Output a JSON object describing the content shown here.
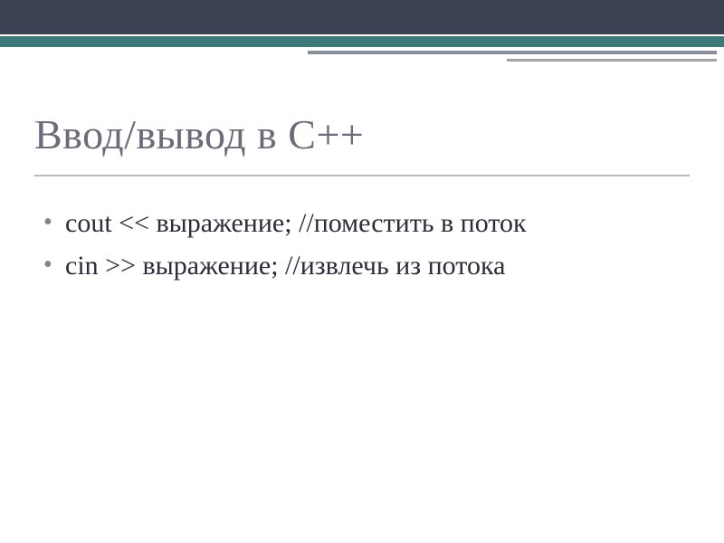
{
  "slide": {
    "title": "Ввод/вывод в C++",
    "bullets": [
      "cout << выражение; //поместить в поток",
      "cin >> выражение; //извлечь из потока"
    ]
  }
}
